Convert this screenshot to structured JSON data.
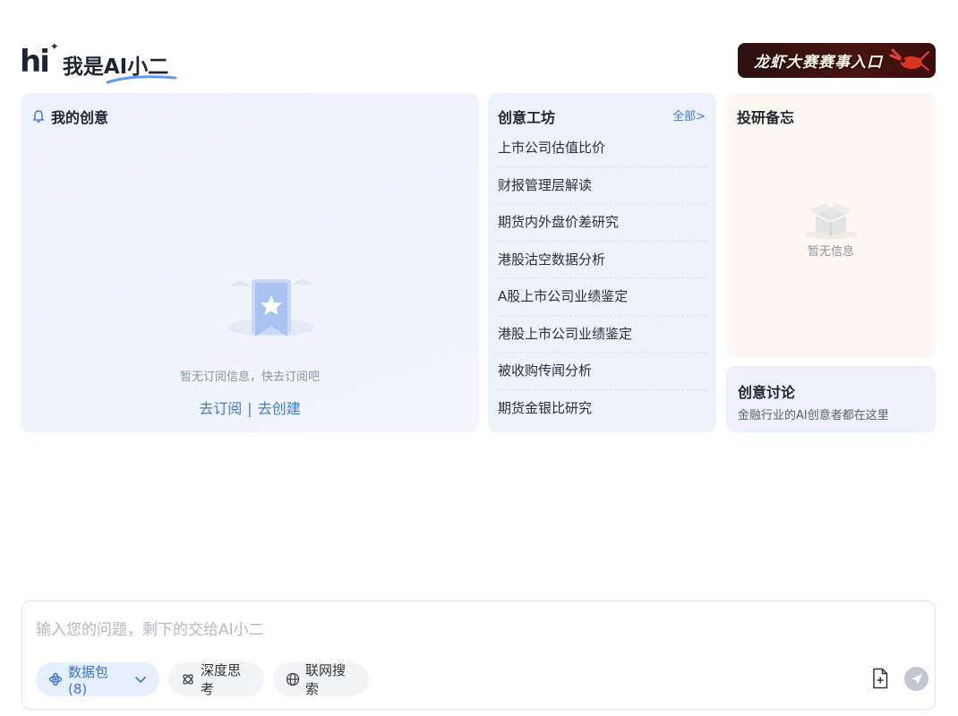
{
  "header": {
    "logo_text": "hi",
    "greeting": "我是AI小二",
    "banner_text": "龙虾大赛赛事入口"
  },
  "my_ideas": {
    "title": "我的创意",
    "empty_text": "暂无订阅信息，快去订阅吧",
    "subscribe_link": "去订阅",
    "separator": "|",
    "create_link": "去创建"
  },
  "workshop": {
    "title": "创意工坊",
    "all_link": "全部>",
    "items": [
      "上市公司估值比价",
      "财报管理层解读",
      "期货内外盘价差研究",
      "港股沽空数据分析",
      "A股上市公司业绩鉴定",
      "港股上市公司业绩鉴定",
      "被收购传闻分析",
      "期货金银比研究"
    ]
  },
  "memo": {
    "title": "投研备忘",
    "empty_text": "暂无信息"
  },
  "discussion": {
    "title": "创意讨论",
    "subtitle": "金融行业的AI创意者都在这里"
  },
  "composer": {
    "placeholder": "输入您的问题，剩下的交给AI小二",
    "data_pack_label": "数据包(8)",
    "deep_think_label": "深度思考",
    "web_search_label": "联网搜索"
  },
  "colors": {
    "accent": "#3f7ad8",
    "card_blue": "#eef2fb",
    "card_cream": "#fdf8f1"
  }
}
